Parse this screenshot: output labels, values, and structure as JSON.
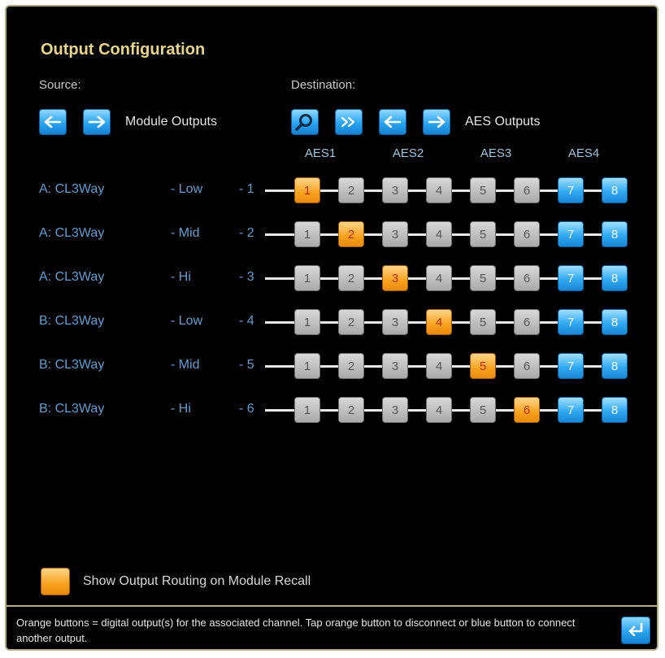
{
  "title": "Output Configuration",
  "source": {
    "label": "Source:",
    "text": "Module Outputs"
  },
  "destination": {
    "label": "Destination:",
    "text": "AES Outputs"
  },
  "aes_groups": [
    "AES1",
    "AES2",
    "AES3",
    "AES4"
  ],
  "rows": [
    {
      "source": "A: CL3Way",
      "band": "- Low",
      "num": "- 1",
      "cells": [
        "1",
        "2",
        "3",
        "4",
        "5",
        "6",
        "7",
        "8"
      ],
      "active": 1
    },
    {
      "source": "A: CL3Way",
      "band": "- Mid",
      "num": "- 2",
      "cells": [
        "1",
        "2",
        "3",
        "4",
        "5",
        "6",
        "7",
        "8"
      ],
      "active": 2
    },
    {
      "source": "A: CL3Way",
      "band": "- Hi",
      "num": "- 3",
      "cells": [
        "1",
        "2",
        "3",
        "4",
        "5",
        "6",
        "7",
        "8"
      ],
      "active": 3
    },
    {
      "source": "B: CL3Way",
      "band": "- Low",
      "num": "- 4",
      "cells": [
        "1",
        "2",
        "3",
        "4",
        "5",
        "6",
        "7",
        "8"
      ],
      "active": 4
    },
    {
      "source": "B: CL3Way",
      "band": "- Mid",
      "num": "- 5",
      "cells": [
        "1",
        "2",
        "3",
        "4",
        "5",
        "6",
        "7",
        "8"
      ],
      "active": 5
    },
    {
      "source": "B: CL3Way",
      "band": "- Hi",
      "num": "- 6",
      "cells": [
        "1",
        "2",
        "3",
        "4",
        "5",
        "6",
        "7",
        "8"
      ],
      "active": 6
    }
  ],
  "recall_option": "Show Output Routing on Module Recall",
  "footer": "Orange buttons = digital output(s) for the associated channel. Tap orange button to disconnect or blue button to connect another output.",
  "colors": {
    "accent_title": "#e8d48a",
    "orange": "#f7a21e",
    "blue": "#2aa4f0",
    "gray": "#bdbdbd"
  },
  "icons": {
    "source_prev": "arrow-left-icon",
    "source_next": "arrow-right-icon",
    "search": "magnifier-icon",
    "fast_forward": "double-chevron-right-icon",
    "dest_prev": "arrow-left-icon",
    "dest_next": "arrow-right-icon",
    "enter": "enter-return-icon"
  }
}
